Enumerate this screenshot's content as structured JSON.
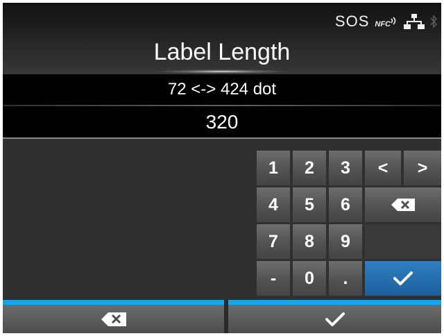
{
  "header": {
    "status_text": "SOS",
    "nfc_label": "NFC",
    "status_icons": [
      "nfc-icon",
      "network-icon",
      "bluetooth-icon"
    ],
    "title": "Label Length"
  },
  "range": {
    "text": "72 <-> 424 dot"
  },
  "input": {
    "value": "320"
  },
  "keypad": {
    "digits": [
      "1",
      "2",
      "3",
      "4",
      "5",
      "6",
      "7",
      "8",
      "9",
      "-",
      "0",
      "."
    ],
    "left_arrow": "<",
    "right_arrow": ">",
    "backspace_icon": "backspace-icon",
    "enter_icon": "checkmark-icon"
  },
  "footer": {
    "cancel_icon": "backspace-icon",
    "confirm_icon": "checkmark-icon"
  },
  "colors": {
    "accent_blue": "#1aa3e6",
    "ok_key_blue": "#1e5f9d",
    "background": "#303030"
  }
}
